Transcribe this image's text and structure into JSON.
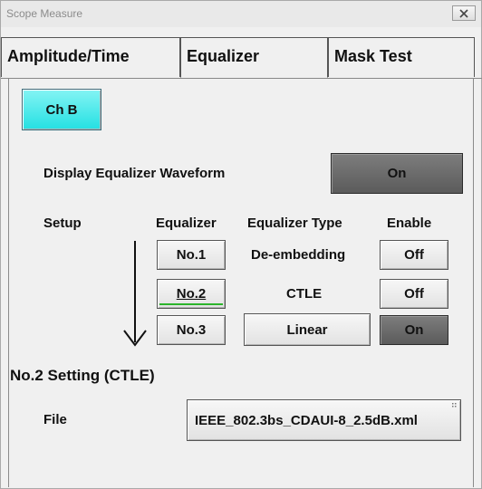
{
  "window": {
    "title": "Scope Measure",
    "close_icon": "close-icon"
  },
  "tabs": [
    {
      "label": "Amplitude/Time",
      "selected": false
    },
    {
      "label": "Equalizer",
      "selected": true
    },
    {
      "label": "Mask Test",
      "selected": false
    }
  ],
  "channel_button": {
    "label": "Ch B",
    "color": "#24e0e2"
  },
  "display_equalizer": {
    "label": "Display Equalizer Waveform",
    "value": "On"
  },
  "table": {
    "headers": {
      "setup": "Setup",
      "equalizer": "Equalizer",
      "type": "Equalizer Type",
      "enable": "Enable"
    },
    "rows": [
      {
        "equalizer": "No.1",
        "type": "De-embedding",
        "enable": "Off"
      },
      {
        "equalizer": "No.2",
        "type": "CTLE",
        "enable": "Off"
      },
      {
        "equalizer": "No.3",
        "type": "Linear",
        "enable": "On"
      }
    ],
    "arrow_icon": "down-arrow-icon"
  },
  "setting": {
    "title": "No.2 Setting (CTLE)",
    "file_label": "File",
    "file_value": "IEEE_802.3bs_CDAUI-8_2.5dB.xml"
  },
  "colors": {
    "accent_cyan": "#24e0e2",
    "on_dark": "#6b6b6b",
    "selected_underline": "#2bb42b"
  }
}
